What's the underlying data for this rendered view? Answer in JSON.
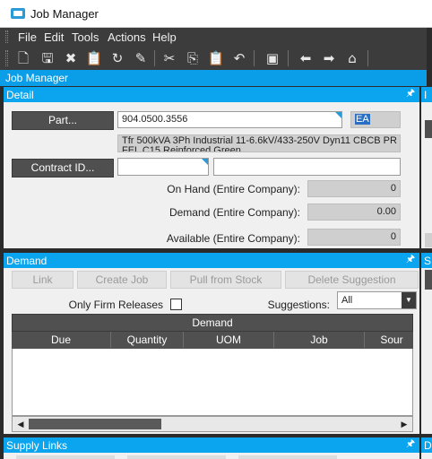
{
  "window": {
    "title": "Job Manager"
  },
  "menu": [
    "File",
    "Edit",
    "Tools",
    "Actions",
    "Help"
  ],
  "toolbar": [
    "new-icon",
    "save-icon",
    "delete-icon",
    "clipboard-icon",
    "refresh-icon",
    "clear-icon",
    "cut-icon",
    "copy-icon",
    "paste-icon",
    "undo-icon",
    "binoculars-icon",
    "back-icon",
    "forward-icon",
    "home-icon"
  ],
  "breadcrumb": "Job Manager",
  "detail": {
    "title": "Detail",
    "part_button": "Part...",
    "part_number": "904.0500.3556",
    "uom": "EA",
    "description": "Tfr 500kVA 3Ph Industrial 11-6.6kV/433-250V Dyn11 CBCB PR FEL C15 Reinforced Green",
    "contract_button": "Contract ID...",
    "contract_id": "",
    "contract_desc": "",
    "on_hand_label": "On Hand (Entire Company):",
    "on_hand": "0",
    "demand_label": "Demand (Entire Company):",
    "demand": "0.00",
    "available_label": "Available (Entire Company):",
    "available": "0"
  },
  "demand": {
    "title": "Demand",
    "buttons": {
      "link": "Link",
      "create_job": "Create Job",
      "pull_from_stock": "Pull from Stock",
      "delete_suggestion": "Delete Suggestion"
    },
    "only_firm_label": "Only Firm Releases",
    "suggestions_label": "Suggestions:",
    "suggestions_value": "All",
    "grid_title": "Demand",
    "columns": [
      "Due",
      "Quantity",
      "UOM",
      "Job",
      "Sour"
    ]
  },
  "supply": {
    "title": "Supply Links"
  },
  "right_panels": {
    "top": "I",
    "mid": "S",
    "bottom": "D"
  },
  "colors": {
    "accent": "#0aa5ee",
    "dark_bar": "#3c3c3c"
  }
}
